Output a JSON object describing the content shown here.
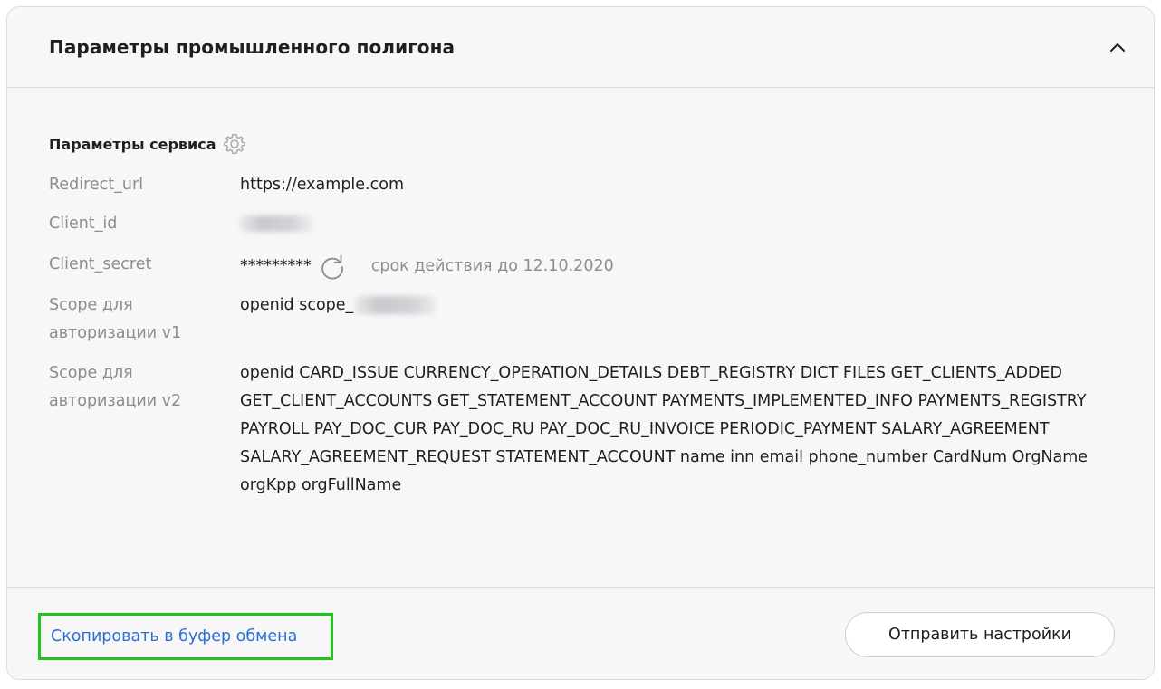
{
  "panel": {
    "title": "Параметры промышленного полигона",
    "collapse_icon": "chevron-up-icon"
  },
  "service": {
    "title": "Параметры сервиса",
    "settings_icon": "gear-icon",
    "rows": {
      "redirect_url": {
        "label": "Redirect_url",
        "value": "https://example.com"
      },
      "client_id": {
        "label": "Client_id"
      },
      "client_secret": {
        "label": "Client_secret",
        "value": "*********",
        "refresh_icon": "refresh-icon",
        "expiry": "срок действия до 12.10.2020"
      },
      "scope_v1": {
        "label": "Scope для авторизации v1",
        "value": "openid scope_"
      },
      "scope_v2": {
        "label": "Scope для авторизации v2",
        "value": "openid CARD_ISSUE CURRENCY_OPERATION_DETAILS DEBT_REGISTRY DICT FILES GET_CLIENTS_ADDED GET_CLIENT_ACCOUNTS GET_STATEMENT_ACCOUNT PAYMENTS_IMPLEMENTED_INFO PAYMENTS_REGISTRY PAYROLL PAY_DOC_CUR PAY_DOC_RU PAY_DOC_RU_INVOICE PERIODIC_PAYMENT SALARY_AGREEMENT SALARY_AGREEMENT_REQUEST STATEMENT_ACCOUNT name inn email phone_number CardNum OrgName orgKpp orgFullName"
      }
    }
  },
  "footer": {
    "copy_label": "Скопировать в буфер обмена",
    "send_label": "Отправить настройки"
  },
  "colors": {
    "panel_bg": "#f7f7f8",
    "border": "#dcdcdf",
    "label": "#8c8c91",
    "link": "#2b6fd6",
    "highlight": "#22c31d"
  }
}
